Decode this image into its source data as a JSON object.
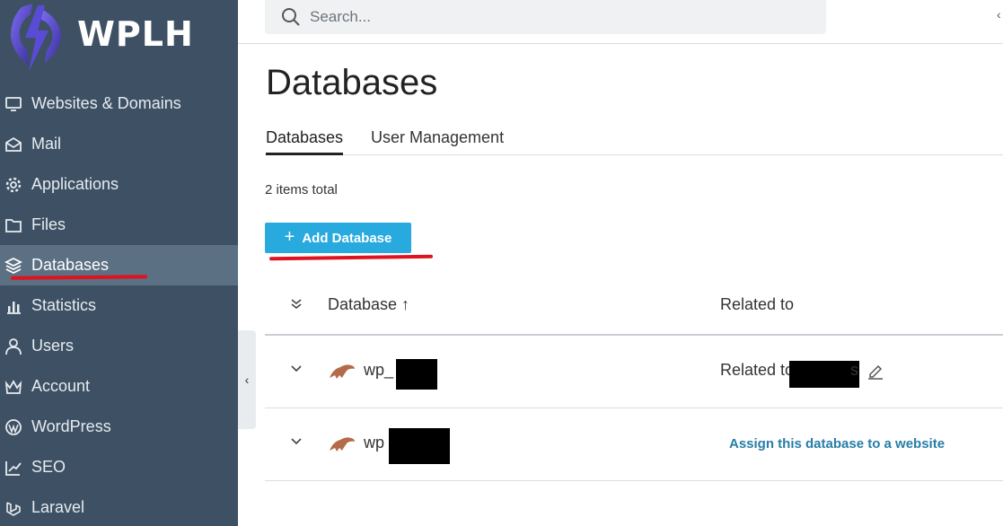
{
  "brand": {
    "name": "WPLH",
    "icon_color": "#6a5acd"
  },
  "sidebar": {
    "items": [
      {
        "label": "Websites & Domains",
        "icon": "monitor-icon",
        "active": false
      },
      {
        "label": "Mail",
        "icon": "mail-icon",
        "active": false
      },
      {
        "label": "Applications",
        "icon": "gear-icon",
        "active": false
      },
      {
        "label": "Files",
        "icon": "folder-icon",
        "active": false
      },
      {
        "label": "Databases",
        "icon": "layers-icon",
        "active": true
      },
      {
        "label": "Statistics",
        "icon": "bar-chart-icon",
        "active": false
      },
      {
        "label": "Users",
        "icon": "user-icon",
        "active": false
      },
      {
        "label": "Account",
        "icon": "crown-icon",
        "active": false
      },
      {
        "label": "WordPress",
        "icon": "wordpress-icon",
        "active": false
      },
      {
        "label": "SEO",
        "icon": "seo-icon",
        "active": false
      },
      {
        "label": "Laravel",
        "icon": "laravel-icon",
        "active": false
      }
    ],
    "collapse_glyph": "‹"
  },
  "header": {
    "search_placeholder": "Search..."
  },
  "page": {
    "title": "Databases",
    "tabs": [
      {
        "label": "Databases",
        "active": true
      },
      {
        "label": "User Management",
        "active": false
      }
    ],
    "items_total": "2 items total",
    "add_button": {
      "label": "Add Database",
      "icon": "plus-icon",
      "color": "#28aade"
    }
  },
  "table": {
    "columns": [
      "Database ↑",
      "Related to"
    ],
    "rows": [
      {
        "name": "wp_",
        "related_text": "Related to",
        "related_suffix": "s",
        "action": "edit"
      },
      {
        "name": "wp",
        "action_link": "Assign this database to a website"
      }
    ]
  },
  "colors": {
    "sidebar_bg": "#3e5164",
    "active_item_bg": "#5b7083",
    "annotation_red": "#e0121f",
    "link": "#267ea6"
  }
}
